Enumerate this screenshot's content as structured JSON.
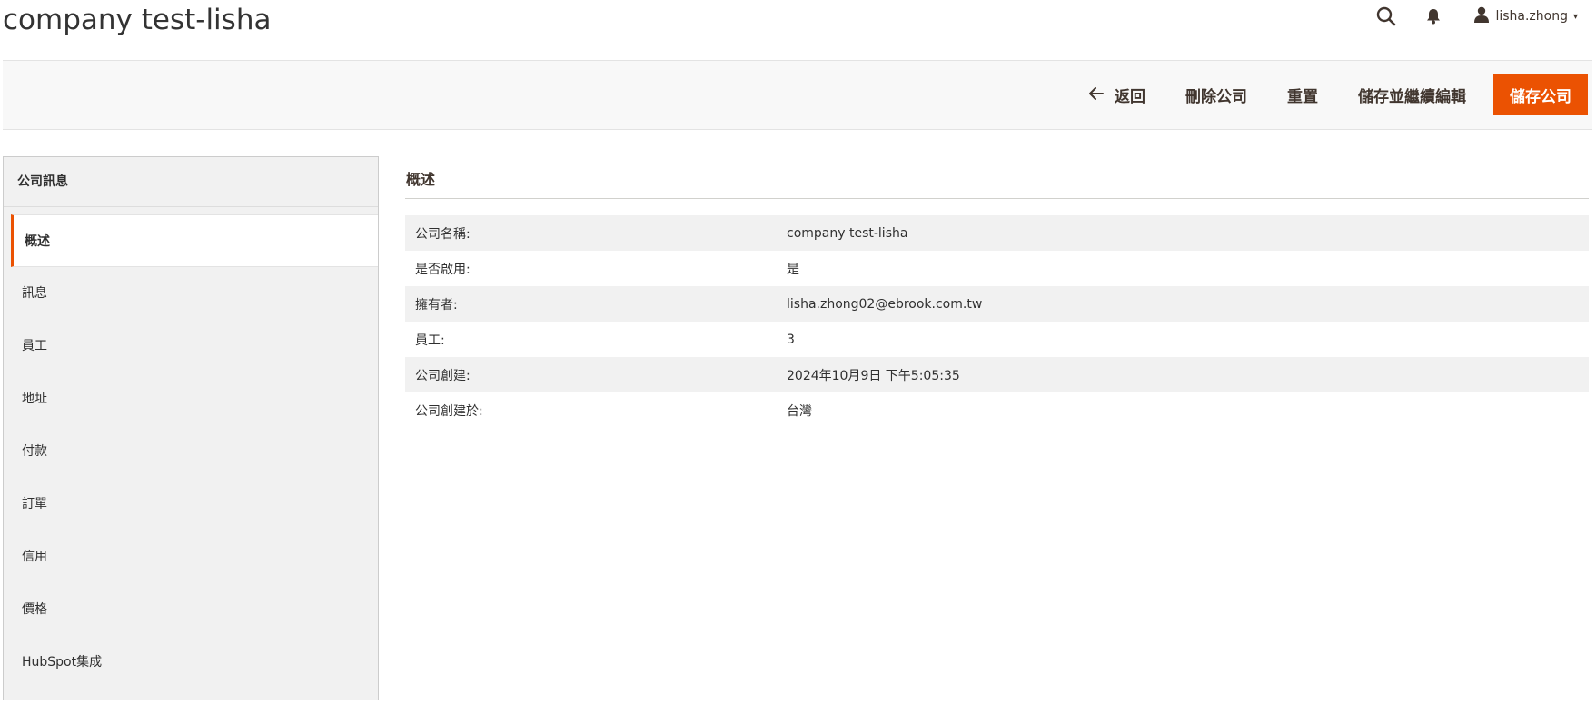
{
  "header": {
    "title": "company test-lisha",
    "icons": {
      "search": "search-icon",
      "notifications": "bell-icon",
      "user": "user-icon"
    },
    "user_name": "lisha.zhong",
    "user_caret": "▾"
  },
  "toolbar": {
    "back_label": "返回",
    "delete_label": "刪除公司",
    "reset_label": "重置",
    "save_continue_label": "儲存並繼續編輯",
    "save_label": "儲存公司",
    "accent_color": "#eb5202"
  },
  "sidebar": {
    "title": "公司訊息",
    "items": [
      {
        "label": "概述",
        "active": true
      },
      {
        "label": "訊息",
        "active": false
      },
      {
        "label": "員工",
        "active": false
      },
      {
        "label": "地址",
        "active": false
      },
      {
        "label": "付款",
        "active": false
      },
      {
        "label": "訂單",
        "active": false
      },
      {
        "label": "信用",
        "active": false
      },
      {
        "label": "價格",
        "active": false
      },
      {
        "label": "HubSpot集成",
        "active": false
      }
    ]
  },
  "main": {
    "section_title": "概述",
    "rows": [
      {
        "label": "公司名稱:",
        "value": "company test-lisha"
      },
      {
        "label": "是否啟用:",
        "value": "是"
      },
      {
        "label": "擁有者:",
        "value": "lisha.zhong02@ebrook.com.tw"
      },
      {
        "label": "員工:",
        "value": "3"
      },
      {
        "label": "公司創建:",
        "value": "2024年10月9日 下午5:05:35"
      },
      {
        "label": "公司創建於:",
        "value": "台灣"
      }
    ]
  }
}
